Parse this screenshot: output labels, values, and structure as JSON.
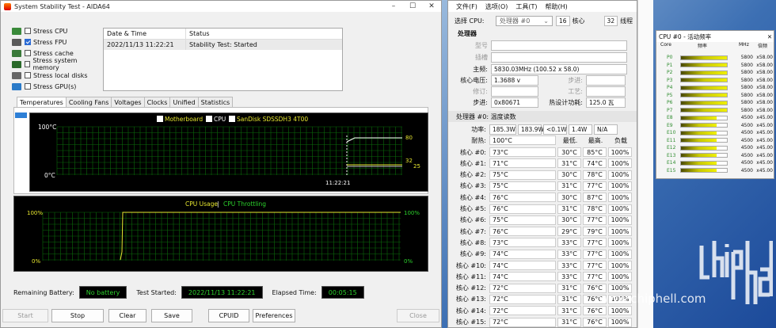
{
  "stability_window": {
    "title": "System Stability Test - AIDA64",
    "stress_options": [
      {
        "label": "Stress CPU",
        "checked": false,
        "color": "#3a8a3a"
      },
      {
        "label": "Stress FPU",
        "checked": true,
        "color": "#5a5a5a"
      },
      {
        "label": "Stress cache",
        "checked": false,
        "color": "#3a7a3a"
      },
      {
        "label": "Stress system memory",
        "checked": false,
        "color": "#2a6a2a"
      },
      {
        "label": "Stress local disks",
        "checked": false,
        "color": "#666666"
      },
      {
        "label": "Stress GPU(s)",
        "checked": false,
        "color": "#2a7ac8"
      }
    ],
    "log": {
      "headers": [
        "Date & Time",
        "Status"
      ],
      "rows": [
        {
          "datetime": "2022/11/13 11:22:21",
          "status": "Stability Test: Started"
        }
      ]
    },
    "tabs": [
      "Temperatures",
      "Cooling Fans",
      "Voltages",
      "Clocks",
      "Unified",
      "Statistics"
    ],
    "active_tab": "Temperatures",
    "temp_graph": {
      "legend": [
        "Motherboard",
        "CPU",
        "SanDisk SDSSDH3 4T00"
      ],
      "y_top": "100°C",
      "y_bottom": "0°C",
      "time_label": "11:22:21",
      "values": [
        "80",
        "32",
        "25"
      ]
    },
    "usage_graph": {
      "title_a": "CPU Usage",
      "separator": "|",
      "title_b": "CPU Throttling",
      "left_top": "100%",
      "left_bottom": "0%",
      "right_top": "100%",
      "right_bottom": "0%"
    },
    "status": {
      "battery_label": "Remaining Battery:",
      "battery_value": "No battery",
      "started_label": "Test Started:",
      "started_value": "2022/11/13 11:22:21",
      "elapsed_label": "Elapsed Time:",
      "elapsed_value": "00:05:15"
    },
    "buttons": {
      "start": "Start",
      "stop": "Stop",
      "clear": "Clear",
      "save": "Save",
      "cpuid": "CPUID",
      "preferences": "Preferences",
      "close": "Close"
    }
  },
  "hwinfo_window": {
    "menu": [
      "文件(F)",
      "选项(O)",
      "工具(T)",
      "帮助(H)"
    ],
    "select_cpu_label": "选择 CPU:",
    "select_cpu_value": "处理器 #0",
    "cores_value": "16",
    "cores_label": "核心",
    "threads_value": "32",
    "threads_label": "线程",
    "processor_group": "处理器",
    "model_label": "型号",
    "stepping_label": "插槽",
    "freq_label": "主频:",
    "freq_value": "5830.03MHz (100.52 x 58.0)",
    "vcore_label": "核心电压:",
    "vcore_value": "1.3688 v",
    "step_label": "步进:",
    "rev_label": "修订:",
    "process_label": "工艺:",
    "stepping2_label": "步进:",
    "stepping2_value": "0x80671",
    "tdp_label": "热设计功耗:",
    "tdp_value": "125.0 瓦",
    "temp_group": "处理器 #0: 温度读数",
    "power_label": "功率:",
    "power_values": [
      "185.3W",
      "183.9W",
      "<0.1W",
      "1.4W",
      "N/A"
    ],
    "tjmax_label": "耐热:",
    "tjmax_value": "100°C",
    "col_min": "最低.",
    "col_max": "最高.",
    "col_load": "负载",
    "cores": [
      {
        "name": "核心 #0:",
        "cur": "73°C",
        "min": "30°C",
        "max": "85°C",
        "load": "100%"
      },
      {
        "name": "核心 #1:",
        "cur": "71°C",
        "min": "31°C",
        "max": "74°C",
        "load": "100%"
      },
      {
        "name": "核心 #2:",
        "cur": "75°C",
        "min": "30°C",
        "max": "78°C",
        "load": "100%"
      },
      {
        "name": "核心 #3:",
        "cur": "75°C",
        "min": "31°C",
        "max": "77°C",
        "load": "100%"
      },
      {
        "name": "核心 #4:",
        "cur": "76°C",
        "min": "30°C",
        "max": "87°C",
        "load": "100%"
      },
      {
        "name": "核心 #5:",
        "cur": "76°C",
        "min": "31°C",
        "max": "78°C",
        "load": "100%"
      },
      {
        "name": "核心 #6:",
        "cur": "75°C",
        "min": "30°C",
        "max": "77°C",
        "load": "100%"
      },
      {
        "name": "核心 #7:",
        "cur": "76°C",
        "min": "29°C",
        "max": "79°C",
        "load": "100%"
      },
      {
        "name": "核心 #8:",
        "cur": "73°C",
        "min": "33°C",
        "max": "77°C",
        "load": "100%"
      },
      {
        "name": "核心 #9:",
        "cur": "74°C",
        "min": "33°C",
        "max": "77°C",
        "load": "100%"
      },
      {
        "name": "核心 #10:",
        "cur": "74°C",
        "min": "33°C",
        "max": "77°C",
        "load": "100%"
      },
      {
        "name": "核心 #11:",
        "cur": "74°C",
        "min": "33°C",
        "max": "77°C",
        "load": "100%"
      },
      {
        "name": "核心 #12:",
        "cur": "72°C",
        "min": "31°C",
        "max": "76°C",
        "load": "100%"
      },
      {
        "name": "核心 #13:",
        "cur": "72°C",
        "min": "31°C",
        "max": "76°C",
        "load": "100%"
      },
      {
        "name": "核心 #14:",
        "cur": "72°C",
        "min": "31°C",
        "max": "76°C",
        "load": "100%"
      },
      {
        "name": "核心 #15:",
        "cur": "72°C",
        "min": "31°C",
        "max": "76°C",
        "load": "100%"
      }
    ]
  },
  "freq_panel": {
    "title": "CPU #0 - 活动频率",
    "col_core": "Core",
    "col_freq": "频率",
    "col_mhz": "MHz",
    "col_mul": "倍频",
    "rows": [
      {
        "core": "P0",
        "level": 1.0,
        "mhz": "5800",
        "mul": "x58.00"
      },
      {
        "core": "P1",
        "level": 1.0,
        "mhz": "5800",
        "mul": "x58.00"
      },
      {
        "core": "P2",
        "level": 1.0,
        "mhz": "5800",
        "mul": "x58.00"
      },
      {
        "core": "P3",
        "level": 1.0,
        "mhz": "5800",
        "mul": "x58.00"
      },
      {
        "core": "P4",
        "level": 1.0,
        "mhz": "5800",
        "mul": "x58.00"
      },
      {
        "core": "P5",
        "level": 1.0,
        "mhz": "5800",
        "mul": "x58.00"
      },
      {
        "core": "P6",
        "level": 1.0,
        "mhz": "5800",
        "mul": "x58.00"
      },
      {
        "core": "P7",
        "level": 1.0,
        "mhz": "5800",
        "mul": "x58.00"
      },
      {
        "core": "E8",
        "level": 0.776,
        "mhz": "4500",
        "mul": "x45.00"
      },
      {
        "core": "E9",
        "level": 0.776,
        "mhz": "4500",
        "mul": "x45.00"
      },
      {
        "core": "E10",
        "level": 0.776,
        "mhz": "4500",
        "mul": "x45.00"
      },
      {
        "core": "E11",
        "level": 0.776,
        "mhz": "4500",
        "mul": "x45.00"
      },
      {
        "core": "E12",
        "level": 0.776,
        "mhz": "4500",
        "mul": "x45.00"
      },
      {
        "core": "E13",
        "level": 0.776,
        "mhz": "4500",
        "mul": "x45.00"
      },
      {
        "core": "E14",
        "level": 0.776,
        "mhz": "4500",
        "mul": "x45.00"
      },
      {
        "core": "E15",
        "level": 0.776,
        "mhz": "4500",
        "mul": "x45.00"
      }
    ]
  },
  "watermark": "www.chiphell.com",
  "colors": {
    "graph_grid": "#0a6a0a",
    "temp_line_white": "#ffffff",
    "temp_line_yellow": "#e8e830",
    "usage_line": "#e8e830",
    "status_green": "#2cd12c"
  }
}
